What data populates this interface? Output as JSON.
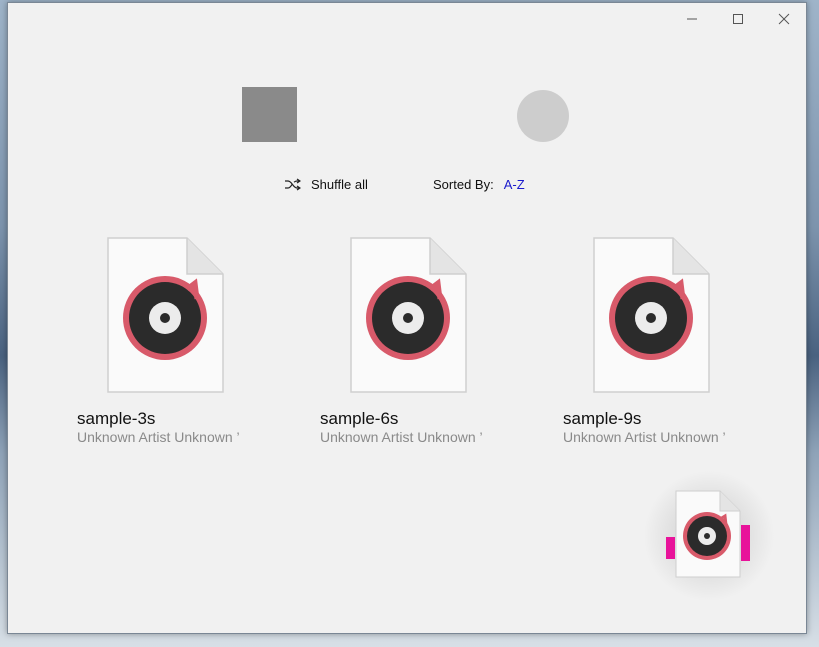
{
  "window": {
    "minimize_icon": "minimize-icon",
    "maximize_icon": "maximize-icon",
    "close_icon": "close-icon"
  },
  "toolbar": {
    "shuffle_label": "Shuffle all",
    "shuffle_icon": "shuffle-icon",
    "sorted_by_label": "Sorted By:",
    "sorted_by_value": "A-Z"
  },
  "tracks": [
    {
      "title": "sample-3s",
      "subtitle": "Unknown Artist Unknown ’"
    },
    {
      "title": "sample-6s",
      "subtitle": "Unknown Artist Unknown ’"
    },
    {
      "title": "sample-9s",
      "subtitle": "Unknown Artist Unknown ’"
    }
  ],
  "colors": {
    "window_bg": "#f1f1f1",
    "accent_link": "#1a1acc",
    "drag_marker": "#e8139a"
  }
}
